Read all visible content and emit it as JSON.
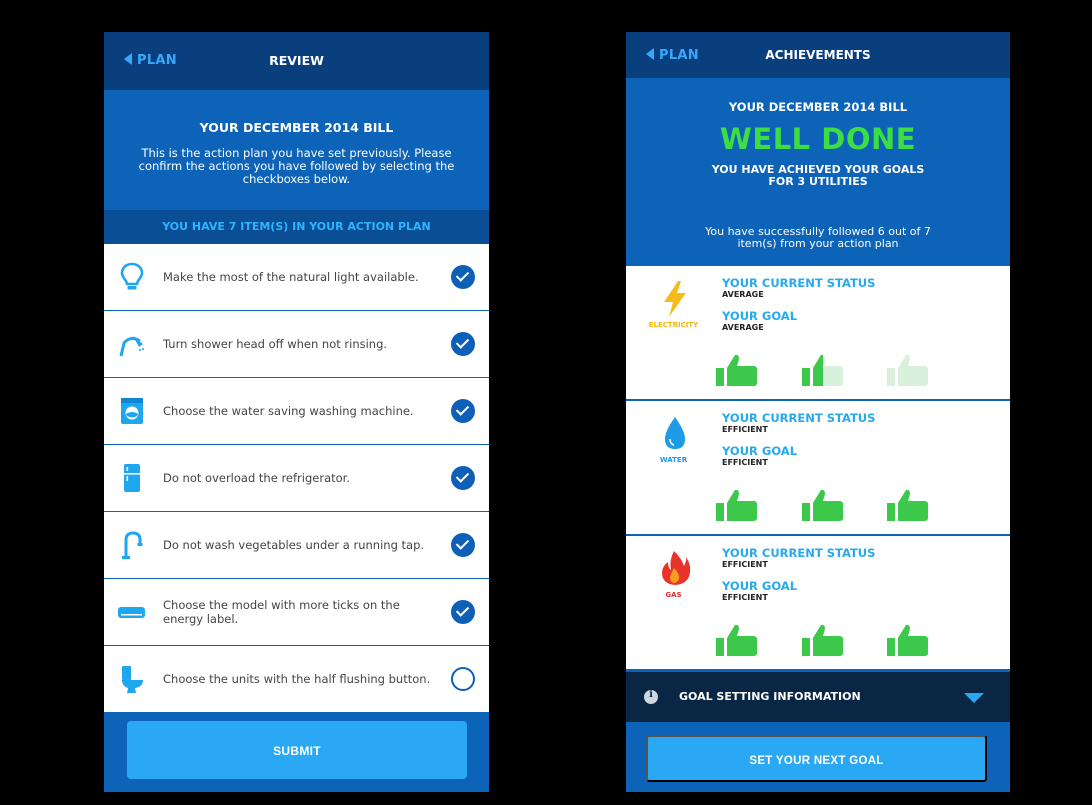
{
  "review": {
    "nav": {
      "back_label": "PLAN",
      "title": "REVIEW"
    },
    "bill_title": "YOUR DECEMBER 2014 BILL",
    "description": "This is the action plan you have set previously. Please confirm the actions you have followed by selecting the checkboxes below.",
    "count_text": "YOU HAVE 7 ITEM(S) IN YOUR ACTION PLAN",
    "items": [
      {
        "icon": "light-bulb-icon",
        "text": "Make the most of the natural light available.",
        "checked": true
      },
      {
        "icon": "shower-head-icon",
        "text": "Turn shower head off when not rinsing.",
        "checked": true
      },
      {
        "icon": "washing-machine-icon",
        "text": "Choose the water saving washing machine.",
        "checked": true
      },
      {
        "icon": "refrigerator-icon",
        "text": "Do not overload the refrigerator.",
        "checked": true
      },
      {
        "icon": "tap-icon",
        "text": "Do not wash vegetables under a running tap.",
        "checked": true
      },
      {
        "icon": "air-conditioner-icon",
        "text": "Choose the model with more ticks on the energy label.",
        "checked": true
      },
      {
        "icon": "toilet-icon",
        "text": "Choose the units with the half flushing button.",
        "checked": false
      }
    ],
    "submit_label": "SUBMIT"
  },
  "achievements": {
    "nav": {
      "back_label": "PLAN",
      "title": "ACHIEVEMENTS"
    },
    "bill_title": "YOUR DECEMBER 2014 BILL",
    "headline": "WELL DONE",
    "goals_line1": "YOU HAVE ACHIEVED YOUR GOALS",
    "goals_line2": "FOR 3 UTILITIES",
    "followed_line1": "You have successfully followed 6 out of 7",
    "followed_line2": "item(s) from your action plan",
    "utilities": [
      {
        "label": "ELECTRICITY",
        "icon": "lightning-bolt-icon",
        "label_color": "#f2b515",
        "status_heading": "YOUR CURRENT STATUS",
        "status": "AVERAGE",
        "goal_heading": "YOUR GOAL",
        "goal": "AVERAGE",
        "rating": 1.5
      },
      {
        "label": "WATER",
        "icon": "water-drop-icon",
        "label_color": "#1e9be6",
        "status_heading": "YOUR CURRENT STATUS",
        "status": "EFFICIENT",
        "goal_heading": "YOUR GOAL",
        "goal": "EFFICIENT",
        "rating": 3
      },
      {
        "label": "GAS",
        "icon": "flame-icon",
        "label_color": "#e62d2d",
        "status_heading": "YOUR CURRENT STATUS",
        "status": "EFFICIENT",
        "goal_heading": "YOUR GOAL",
        "goal": "EFFICIENT",
        "rating": 3
      }
    ],
    "goal_info_label": "GOAL SETTING INFORMATION",
    "next_goal_label": "SET YOUR  NEXT GOAL"
  },
  "colors": {
    "accent": "#2aa8f3",
    "navy": "#0a3f7e",
    "blue": "#0c63b8",
    "thumb_green": "#3cc84a",
    "thumb_light": "#d8f0dc"
  }
}
